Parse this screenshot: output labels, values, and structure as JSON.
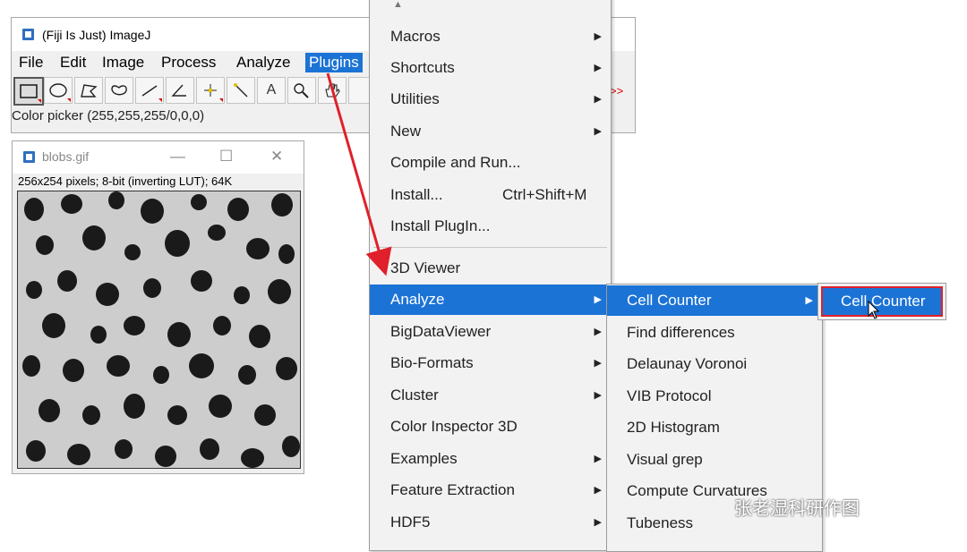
{
  "main_window": {
    "title": "(Fiji Is Just) ImageJ",
    "menus": [
      "File",
      "Edit",
      "Image",
      "Process",
      "Analyze",
      "Plugins"
    ],
    "active_menu": "Plugins",
    "status": "Color picker (255,255,255/0,0,0)",
    "more_tools": ">>"
  },
  "image_window": {
    "title": "blobs.gif",
    "info": "256x254 pixels; 8-bit (inverting LUT); 64K",
    "controls": [
      "—",
      "☐",
      "✕"
    ]
  },
  "plugins_menu": {
    "scroll_up": "▲",
    "items": [
      {
        "label": "Macros",
        "submenu": true
      },
      {
        "label": "Shortcuts",
        "submenu": true
      },
      {
        "label": "Utilities",
        "submenu": true
      },
      {
        "label": "New",
        "submenu": true
      },
      {
        "label": "Compile and Run...",
        "submenu": false
      },
      {
        "label": "Install...",
        "shortcut": "Ctrl+Shift+M",
        "submenu": false
      },
      {
        "label": "Install PlugIn...",
        "submenu": false
      },
      {
        "label": "3D Viewer",
        "submenu": false
      },
      {
        "label": "Analyze",
        "submenu": true,
        "highlighted": true
      },
      {
        "label": "BigDataViewer",
        "submenu": true
      },
      {
        "label": "Bio-Formats",
        "submenu": true
      },
      {
        "label": "Cluster",
        "submenu": true
      },
      {
        "label": "Color Inspector 3D",
        "submenu": false
      },
      {
        "label": "Examples",
        "submenu": true
      },
      {
        "label": "Feature Extraction",
        "submenu": true
      },
      {
        "label": "HDF5",
        "submenu": true
      }
    ]
  },
  "analyze_submenu": {
    "items": [
      {
        "label": "Cell Counter",
        "submenu": true,
        "highlighted": true
      },
      {
        "label": "Find differences"
      },
      {
        "label": "Delaunay Voronoi"
      },
      {
        "label": "VIB Protocol"
      },
      {
        "label": "2D Histogram"
      },
      {
        "label": "Visual grep"
      },
      {
        "label": "Compute Curvatures"
      },
      {
        "label": "Tubeness"
      }
    ]
  },
  "cell_counter_submenu": {
    "items": [
      {
        "label": "Cell Counter",
        "highlighted": true
      }
    ]
  },
  "watermark": "张老湿科研作图",
  "colors": {
    "highlight": "#1c73d6",
    "annotation_red": "#e0202a"
  },
  "icons": [
    "rectangle-tool-icon",
    "oval-tool-icon",
    "polygon-tool-icon",
    "freehand-tool-icon",
    "line-tool-icon",
    "angle-tool-icon",
    "point-tool-icon",
    "wand-tool-icon",
    "text-tool-icon",
    "magnifier-tool-icon",
    "hand-tool-icon"
  ]
}
